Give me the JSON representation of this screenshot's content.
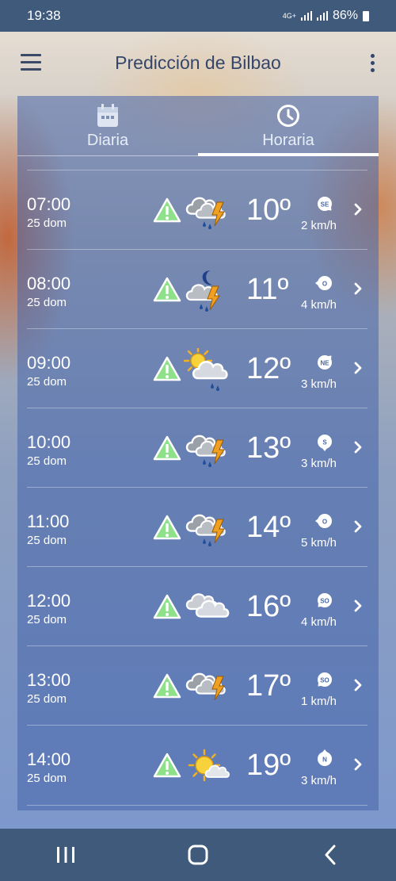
{
  "status": {
    "time": "19:38",
    "network": "4G+",
    "battery": "86%"
  },
  "appbar": {
    "title": "Predicción de Bilbao"
  },
  "tabs": [
    {
      "label": "Diaria",
      "icon": "calendar-icon",
      "selected": false
    },
    {
      "label": "Horaria",
      "icon": "clock-icon",
      "selected": true
    }
  ],
  "hours": [
    {
      "time": "07:00",
      "date": "25 dom",
      "icon": "storm-cloud-rain",
      "temp": "10º",
      "wind_dir": "SE",
      "wind_speed": "2 km/h"
    },
    {
      "time": "08:00",
      "date": "25 dom",
      "icon": "night-storm",
      "temp": "11º",
      "wind_dir": "O",
      "wind_speed": "4 km/h"
    },
    {
      "time": "09:00",
      "date": "25 dom",
      "icon": "sun-cloud-rain",
      "temp": "12º",
      "wind_dir": "NE",
      "wind_speed": "3 km/h"
    },
    {
      "time": "10:00",
      "date": "25 dom",
      "icon": "storm-cloud-rain",
      "temp": "13º",
      "wind_dir": "S",
      "wind_speed": "3 km/h"
    },
    {
      "time": "11:00",
      "date": "25 dom",
      "icon": "storm-cloud-rain",
      "temp": "14º",
      "wind_dir": "O",
      "wind_speed": "5 km/h"
    },
    {
      "time": "12:00",
      "date": "25 dom",
      "icon": "cloudy",
      "temp": "16º",
      "wind_dir": "SO",
      "wind_speed": "4 km/h"
    },
    {
      "time": "13:00",
      "date": "25 dom",
      "icon": "storm-cloud",
      "temp": "17º",
      "wind_dir": "SO",
      "wind_speed": "1 km/h"
    },
    {
      "time": "14:00",
      "date": "25 dom",
      "icon": "sun-cloud",
      "temp": "19º",
      "wind_dir": "N",
      "wind_speed": "3 km/h"
    }
  ],
  "colors": {
    "warning": "#8ee08a",
    "bolt": "#f0a020",
    "rain": "#1f4f9a",
    "accent": "#ffffff"
  }
}
